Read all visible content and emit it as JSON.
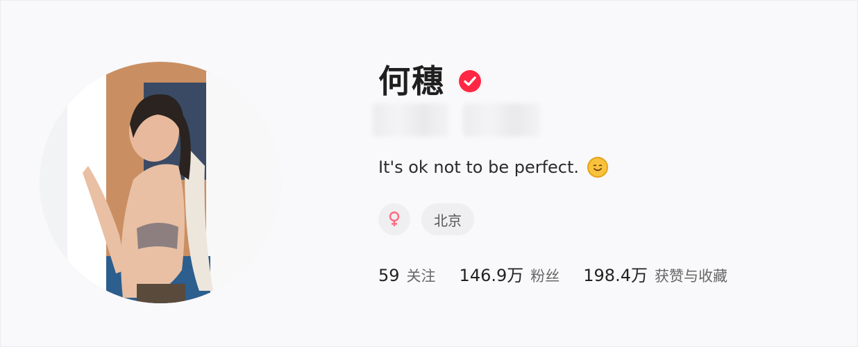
{
  "profile": {
    "name": "何穗",
    "bio": "It's ok not to be perfect.",
    "bio_emoji": "smiling-face-icon",
    "verified_icon": "verified-check-icon",
    "gender_icon": "female-icon",
    "location": "北京",
    "colors": {
      "verified": "#ff2744",
      "female": "#ff6b81"
    }
  },
  "stats": [
    {
      "value": "59",
      "label": "关注"
    },
    {
      "value": "146.9万",
      "label": "粉丝"
    },
    {
      "value": "198.4万",
      "label": "获赞与收藏"
    }
  ]
}
